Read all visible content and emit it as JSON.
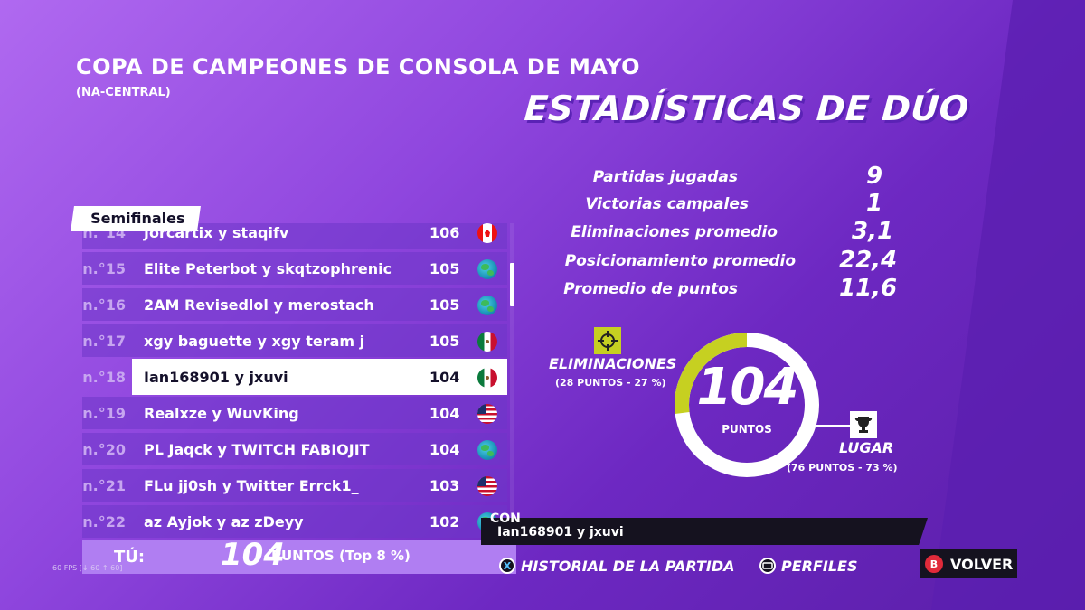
{
  "header": {
    "title": "COPA DE CAMPEONES DE CONSOLA DE MAYO",
    "region": "(NA-CENTRAL)",
    "section_title": "ESTADÍSTICAS DE DÚO"
  },
  "stats": [
    {
      "label": "Partidas jugadas",
      "value": "9"
    },
    {
      "label": "Victorias campales",
      "value": "1"
    },
    {
      "label": "Eliminaciones promedio",
      "value": "3,1"
    },
    {
      "label": "Posicionamiento promedio",
      "value": "22,4"
    },
    {
      "label": "Promedio de puntos",
      "value": "11,6"
    }
  ],
  "leaderboard": {
    "tab_label": "Semifinales",
    "rows": [
      {
        "rank": "n.°14",
        "names": "Jorcartix y staqifv",
        "score": "106",
        "flag": "ca"
      },
      {
        "rank": "n.°15",
        "names": "Elite Peterbot y skqtzophrenic",
        "score": "105",
        "flag": "globe"
      },
      {
        "rank": "n.°16",
        "names": "2AM Revisedlol y merostach",
        "score": "105",
        "flag": "globe"
      },
      {
        "rank": "n.°17",
        "names": "xgy baguette y xgy teram j",
        "score": "105",
        "flag": "mx"
      },
      {
        "rank": "n.°18",
        "names": "Ian168901 y jxuvi",
        "score": "104",
        "flag": "mx",
        "highlight": true
      },
      {
        "rank": "n.°19",
        "names": "Realxze y WuvKing",
        "score": "104",
        "flag": "us"
      },
      {
        "rank": "n.°20",
        "names": "PL Jaqck y TWITCH FABIOJIT",
        "score": "104",
        "flag": "globe"
      },
      {
        "rank": "n.°21",
        "names": "FLu jj0sh y Twitter Errck1_",
        "score": "103",
        "flag": "us"
      },
      {
        "rank": "n.°22",
        "names": "az Ayjok y az zDeyy",
        "score": "102",
        "flag": "globe"
      }
    ]
  },
  "you": {
    "label": "TÚ:",
    "points": "104",
    "unit": "PUNTOS",
    "top": "(Top 8 %)"
  },
  "fps": "60 FPS [↓ 60 ↑ 60]",
  "ring": {
    "value": "104",
    "unit": "PUNTOS",
    "elim_fraction": 0.27,
    "elim_color": "#c6d021",
    "place_color": "#ffffff"
  },
  "eliminations": {
    "label": "ELIMINACIONES",
    "detail": "(28 PUNTOS - 27 %)"
  },
  "placement": {
    "label": "LUGAR",
    "detail": "(76 PUNTOS - 73 %)"
  },
  "partner": {
    "label": "CON",
    "value": "Ian168901 y jxuvi"
  },
  "footer": {
    "history_label": "HISTORIAL DE LA PARTIDA",
    "history_icon": "X",
    "profiles_label": "PERFILES",
    "back_label": "VOLVER",
    "back_icon": "B"
  }
}
